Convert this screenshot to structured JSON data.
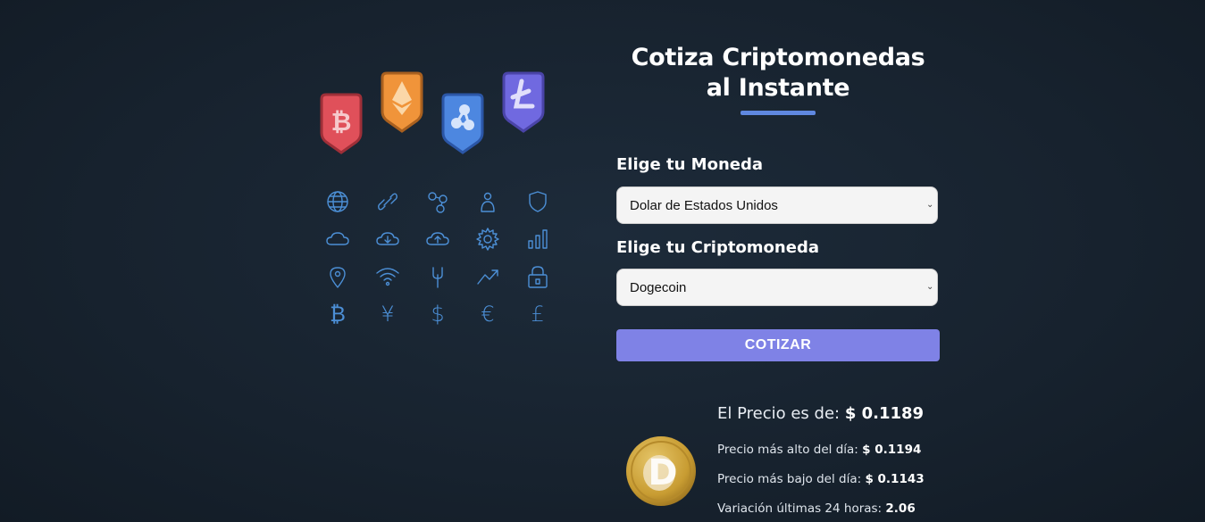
{
  "hero": {
    "badges": [
      {
        "icon": "bitcoin-badge-icon",
        "color": "#e0505a",
        "border": "#9e2f38"
      },
      {
        "icon": "ethereum-badge-icon",
        "color": "#f0943a",
        "border": "#a9601f"
      },
      {
        "icon": "ripple-badge-icon",
        "color": "#4d87e0",
        "border": "#2b56a6"
      },
      {
        "icon": "litecoin-badge-icon",
        "color": "#7069e0",
        "border": "#4a44a8"
      }
    ],
    "icons": [
      "globe-icon",
      "link-icon",
      "network-icon",
      "person-icon",
      "shield-icon",
      "cloud-icon",
      "cloud-download-icon",
      "cloud-upload-icon",
      "gear-icon",
      "bar-chart-icon",
      "location-pin-icon",
      "wifi-icon",
      "fork-icon",
      "trend-up-icon",
      "lock-icon",
      "bitcoin-icon",
      "yen-icon",
      "dollar-icon",
      "euro-icon",
      "pound-icon"
    ],
    "currency_glyphs": {
      "bitcoin": "₿",
      "yen": "¥",
      "dollar": "$",
      "euro": "€",
      "pound": "£"
    }
  },
  "form": {
    "title": "Cotiza Criptomonedas al Instante",
    "currency_label": "Elige tu Moneda",
    "currency_selected": "Dolar de Estados Unidos",
    "crypto_label": "Elige tu Criptomoneda",
    "crypto_selected": "Dogecoin",
    "submit_label": "COTIZAR",
    "accent_color": "#7f82e6"
  },
  "result": {
    "price_label": "El Precio es de:",
    "price_value": "$ 0.1189",
    "high_label": "Precio más alto del día:",
    "high_value": "$ 0.1194",
    "low_label": "Precio más bajo del día:",
    "low_value": "$ 0.1143",
    "change_label": "Variación últimas 24 horas:",
    "change_value": "2.06",
    "coin_icon": "dogecoin-logo-icon"
  }
}
